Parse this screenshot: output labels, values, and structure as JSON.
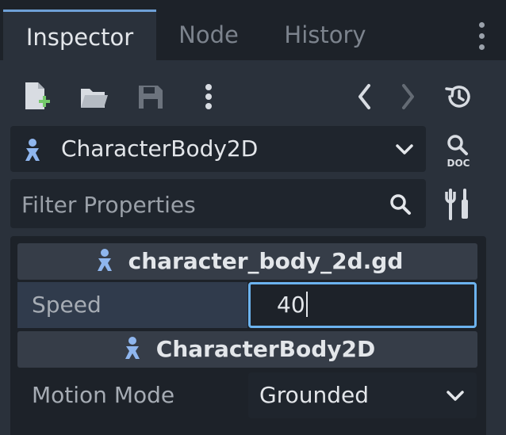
{
  "tabs": [
    {
      "label": "Inspector",
      "active": true
    },
    {
      "label": "Node",
      "active": false
    },
    {
      "label": "History",
      "active": false
    }
  ],
  "toolbar": {
    "icons": [
      "new-resource-icon",
      "open-folder-icon",
      "save-icon",
      "more-vertical-icon",
      "back-icon",
      "forward-icon",
      "history-icon"
    ]
  },
  "node_selector": {
    "label": "CharacterBody2D",
    "icon": "character-body-2d-icon"
  },
  "filter": {
    "placeholder": "Filter Properties"
  },
  "sections": [
    {
      "title": "character_body_2d.gd"
    },
    {
      "title": "CharacterBody2D"
    }
  ],
  "properties": {
    "speed": {
      "label": "Speed",
      "value": "40"
    },
    "motion_mode": {
      "label": "Motion Mode",
      "value": "Grounded"
    }
  },
  "colors": {
    "accent": "#6cb3ef",
    "panel": "#2a313b",
    "background": "#1d2229",
    "icon_blue": "#8fb6ee",
    "icon_green": "#74c96a"
  }
}
